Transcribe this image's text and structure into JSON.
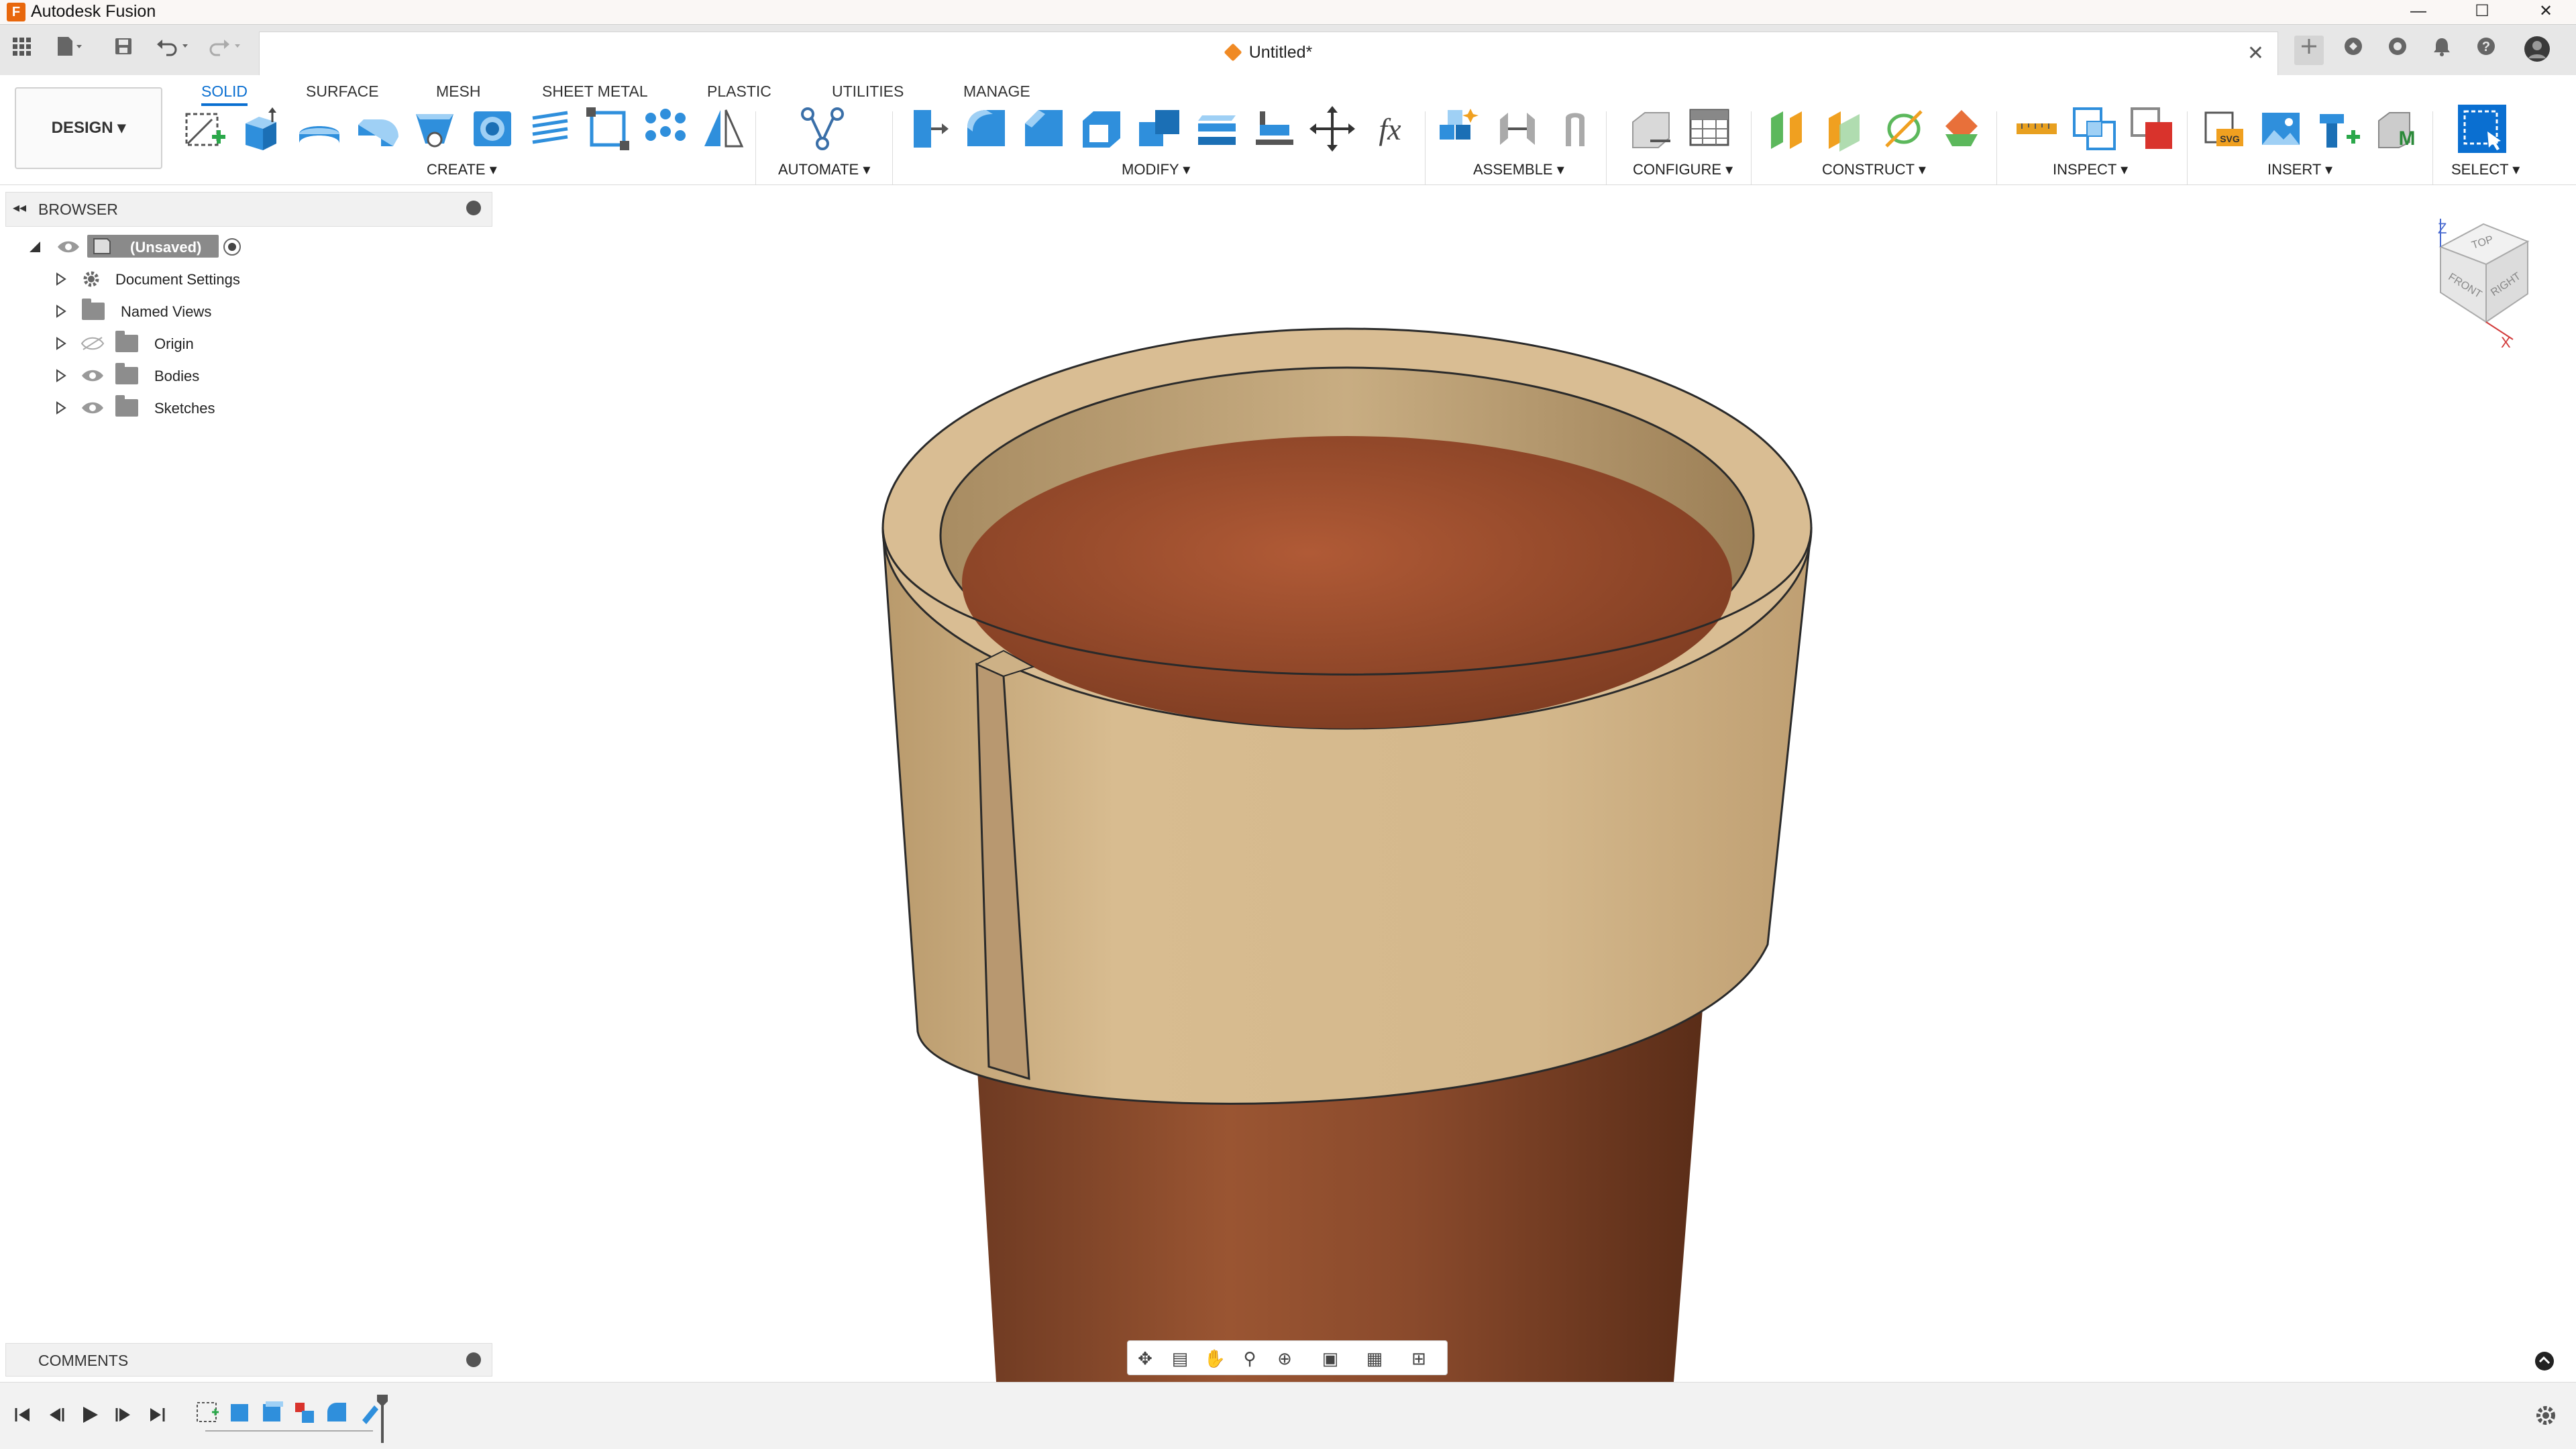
{
  "window": {
    "app_title": "Autodesk Fusion",
    "minimize": "—",
    "maximize": "☐",
    "close": "✕"
  },
  "document_tab": {
    "title": "Untitled*",
    "close": "✕"
  },
  "ribbon": {
    "workspace": "DESIGN",
    "tabs": [
      "SOLID",
      "SURFACE",
      "MESH",
      "SHEET METAL",
      "PLASTIC",
      "UTILITIES",
      "MANAGE"
    ],
    "active_tab": "SOLID",
    "groups": {
      "create": "CREATE",
      "automate": "AUTOMATE",
      "modify": "MODIFY",
      "assemble": "ASSEMBLE",
      "configure": "CONFIGURE",
      "construct": "CONSTRUCT",
      "inspect": "INSPECT",
      "insert": "INSERT",
      "select": "SELECT"
    }
  },
  "browser": {
    "title": "BROWSER",
    "root": "(Unsaved)",
    "items": [
      {
        "label": "Document Settings",
        "icon": "gear-icon"
      },
      {
        "label": "Named Views",
        "icon": "folder-icon"
      },
      {
        "label": "Origin",
        "icon": "folder-icon",
        "hidden": true
      },
      {
        "label": "Bodies",
        "icon": "folder-icon"
      },
      {
        "label": "Sketches",
        "icon": "folder-icon"
      }
    ]
  },
  "comments": {
    "title": "COMMENTS"
  },
  "viewcube": {
    "top": "TOP",
    "front": "FRONT",
    "right": "RIGHT",
    "axis_z": "Z",
    "axis_x": "X"
  },
  "colors": {
    "accent": "#0a6fd1",
    "sleeve": "#d5b78c",
    "pot": "#9a4f2a"
  }
}
